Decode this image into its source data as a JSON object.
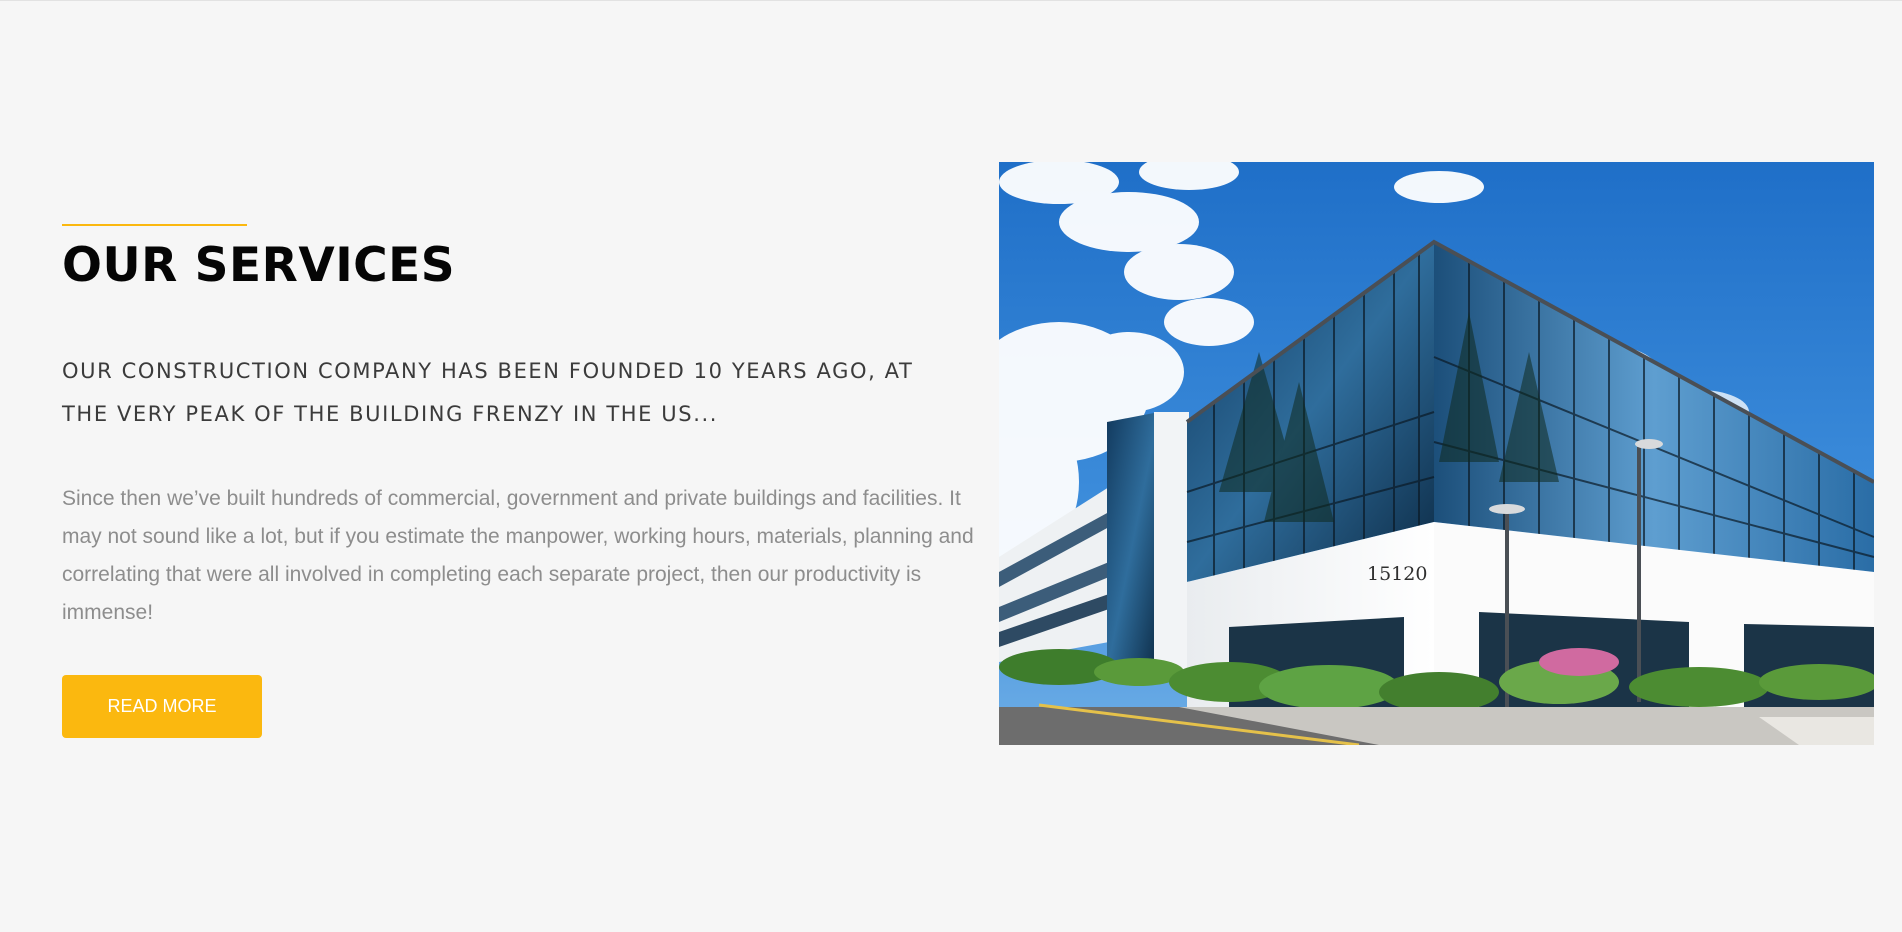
{
  "services": {
    "title": "OUR SERVICES",
    "lead": "OUR CONSTRUCTION COMPANY HAS BEEN FOUNDED 10 YEARS AGO, AT THE VERY PEAK OF THE BUILDING FRENZY IN THE US...",
    "body": "Since then we’ve built hundreds of commercial, government and private buildings and facilities. It may not sound like a lot, but if you estimate the manpower, working hours, materials, planning and correlating that were all involved in completing each separate project, then our productivity is immense!",
    "button_label": "READ MORE",
    "building_number": "15120"
  },
  "colors": {
    "accent": "#fbb80f",
    "heading": "#050505",
    "lead_text": "#3b3b3b",
    "body_text": "#8d8d8d",
    "background": "#f6f6f6"
  }
}
